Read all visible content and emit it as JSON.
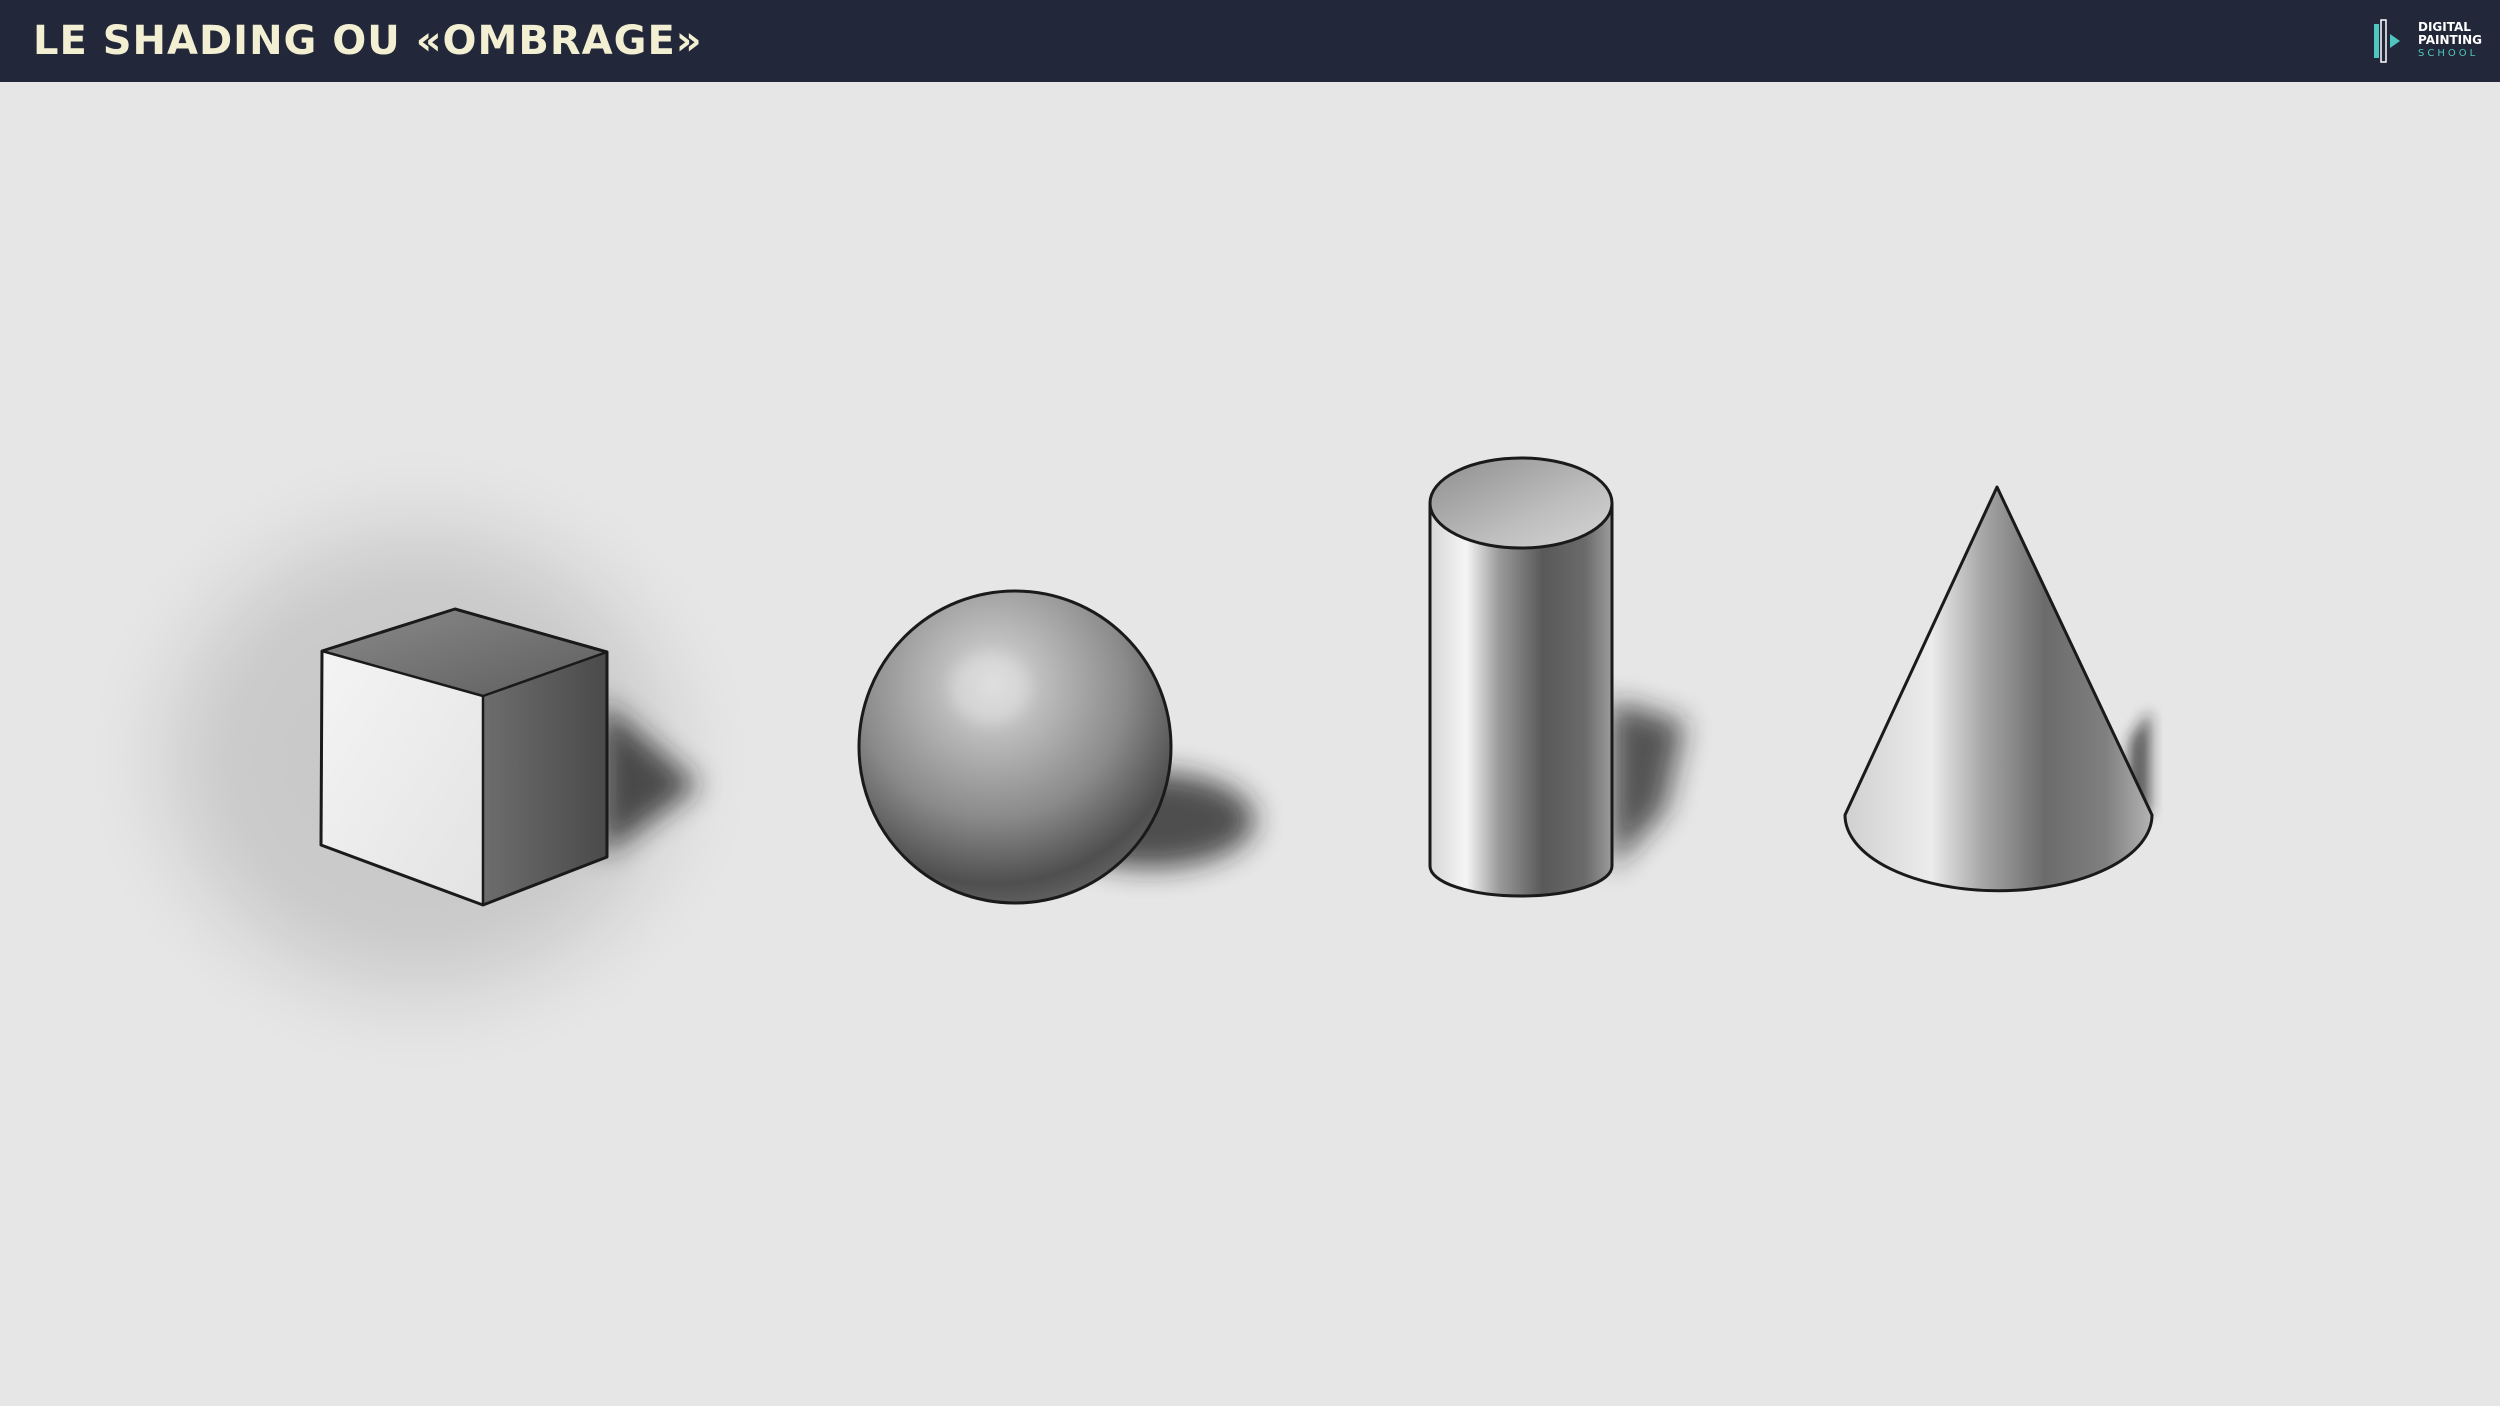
{
  "header": {
    "title": "LE SHADING OU «OMBRAGE»",
    "background": "#222739",
    "title_color": "#f3efd2"
  },
  "logo": {
    "line1": "DIGITAL",
    "line2": "PAINTING",
    "line3": "SCHOOL",
    "accent": "#4fc6c0"
  },
  "canvas": {
    "background": "#e6e6e6"
  },
  "shapes": [
    "cube",
    "sphere",
    "cylinder",
    "cone"
  ]
}
